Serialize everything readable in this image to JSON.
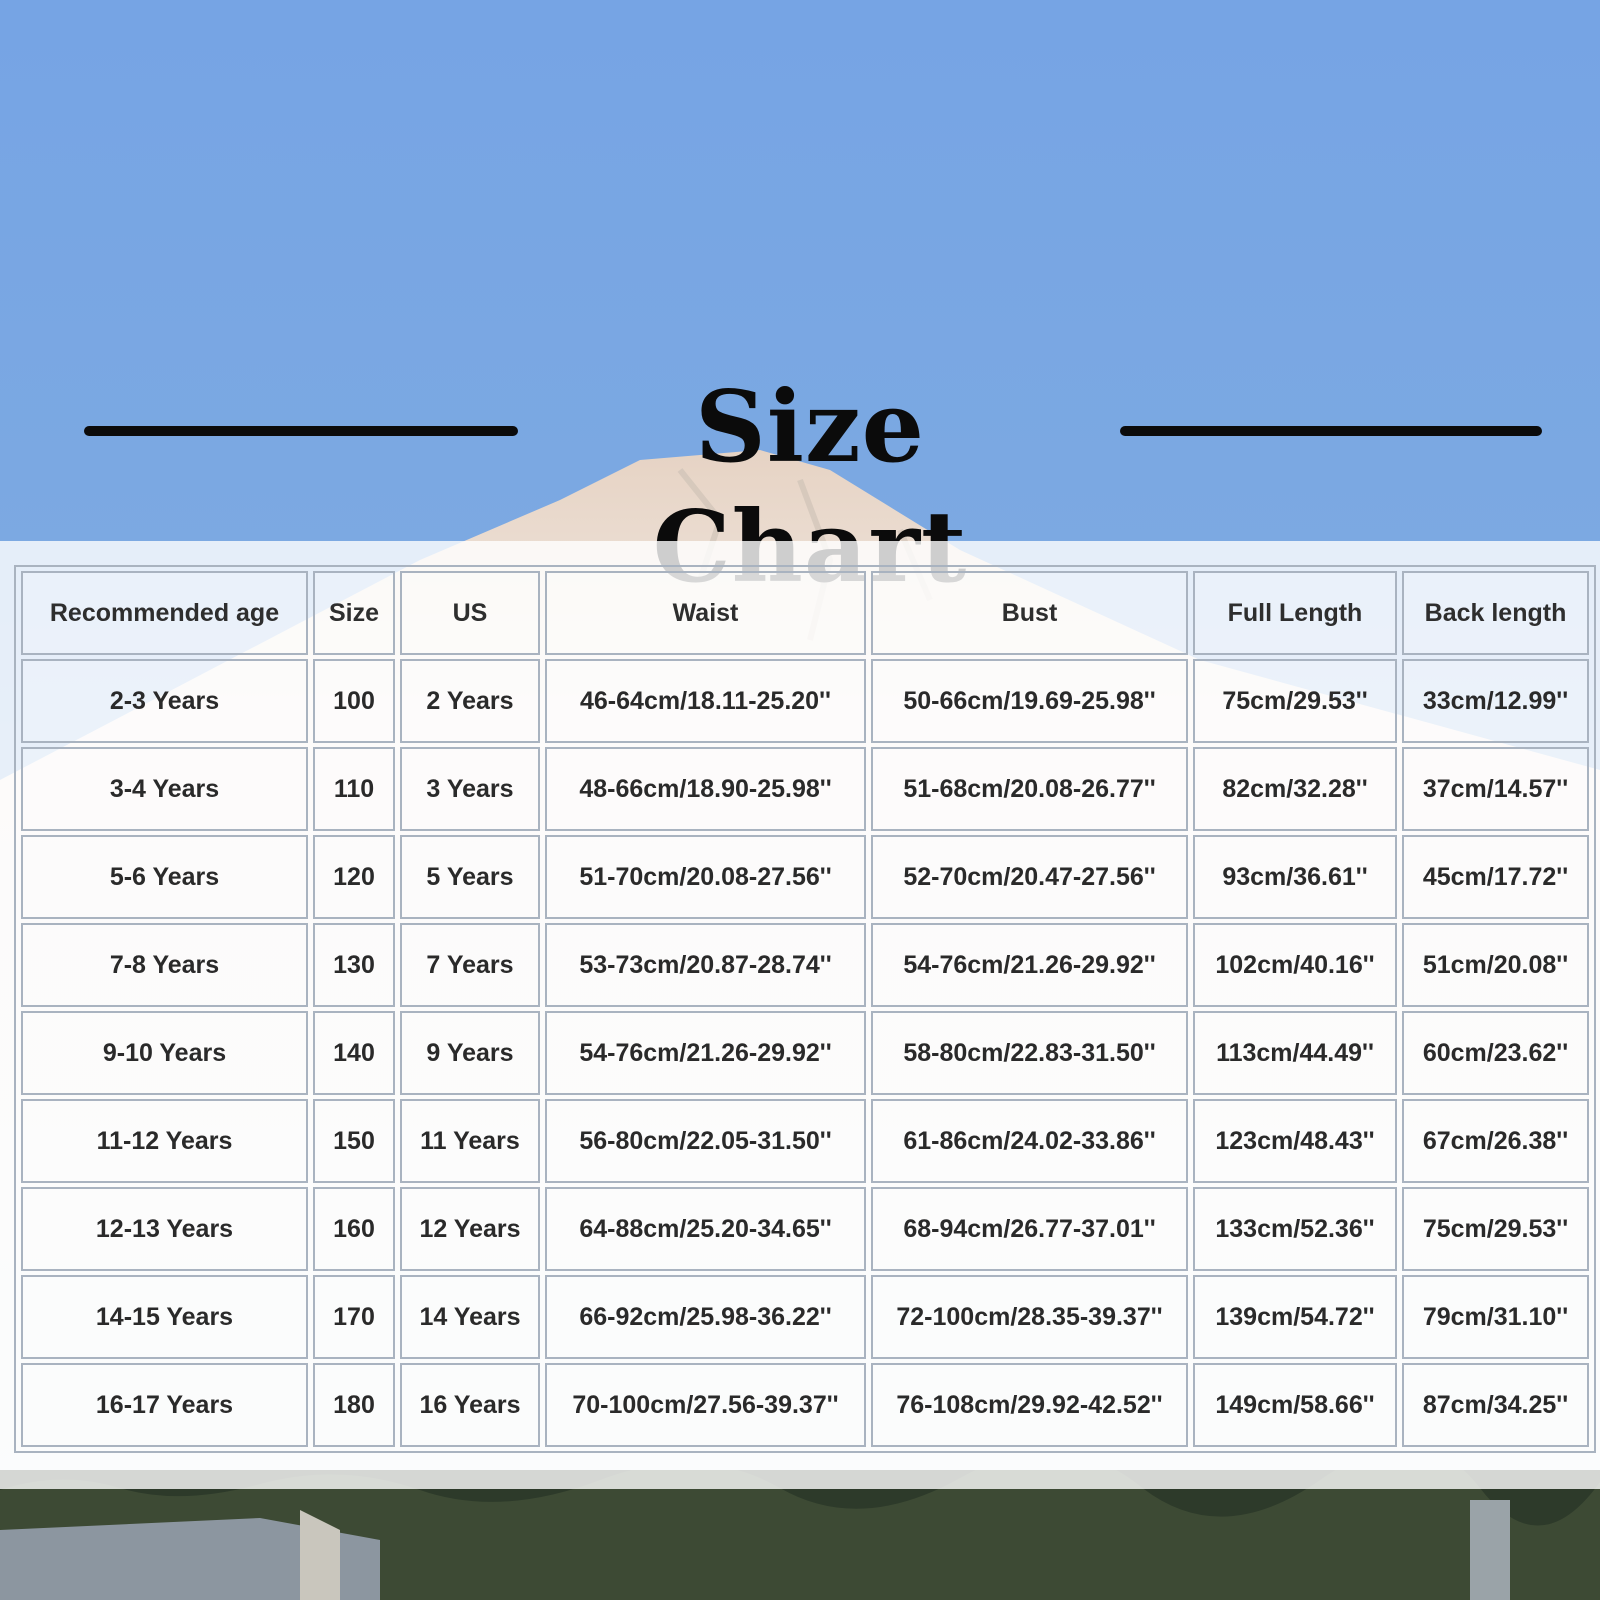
{
  "title": "Size Chart",
  "table": {
    "headers": [
      "Recommended age",
      "Size",
      "US",
      "Waist",
      "Bust",
      "Full Length",
      "Back length"
    ],
    "rows": [
      [
        "2-3 Years",
        "100",
        "2 Years",
        "46-64cm/18.11-25.20''",
        "50-66cm/19.69-25.98''",
        "75cm/29.53''",
        "33cm/12.99''"
      ],
      [
        "3-4 Years",
        "110",
        "3 Years",
        "48-66cm/18.90-25.98''",
        "51-68cm/20.08-26.77''",
        "82cm/32.28''",
        "37cm/14.57''"
      ],
      [
        "5-6 Years",
        "120",
        "5 Years",
        "51-70cm/20.08-27.56''",
        "52-70cm/20.47-27.56''",
        "93cm/36.61''",
        "45cm/17.72''"
      ],
      [
        "7-8 Years",
        "130",
        "7 Years",
        "53-73cm/20.87-28.74''",
        "54-76cm/21.26-29.92''",
        "102cm/40.16''",
        "51cm/20.08''"
      ],
      [
        "9-10 Years",
        "140",
        "9 Years",
        "54-76cm/21.26-29.92''",
        "58-80cm/22.83-31.50''",
        "113cm/44.49''",
        "60cm/23.62''"
      ],
      [
        "11-12 Years",
        "150",
        "11 Years",
        "56-80cm/22.05-31.50''",
        "61-86cm/24.02-33.86''",
        "123cm/48.43''",
        "67cm/26.38''"
      ],
      [
        "12-13 Years",
        "160",
        "12 Years",
        "64-88cm/25.20-34.65''",
        "68-94cm/26.77-37.01''",
        "133cm/52.36''",
        "75cm/29.53''"
      ],
      [
        "14-15 Years",
        "170",
        "14 Years",
        "66-92cm/25.98-36.22''",
        "72-100cm/28.35-39.37''",
        "139cm/54.72''",
        "79cm/31.10''"
      ],
      [
        "16-17 Years",
        "180",
        "16 Years",
        "70-100cm/27.56-39.37''",
        "76-108cm/29.92-42.52''",
        "149cm/58.66''",
        "87cm/34.25''"
      ]
    ]
  }
}
